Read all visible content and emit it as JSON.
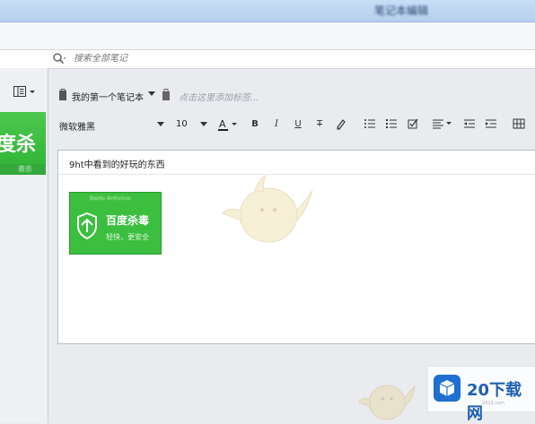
{
  "window": {
    "title": "笔记本编辑"
  },
  "search": {
    "placeholder": "搜索全部笔记"
  },
  "sidebar": {
    "thumb_text": "度杀",
    "thumb_foot": "查杀"
  },
  "note": {
    "notebook_name": "我的第一个笔记本",
    "tag_hint": "点击这里添加标签...",
    "title": "9ht中看到的好玩的东西"
  },
  "toolbar": {
    "font_family": "微软雅黑",
    "font_size": "10",
    "bold": "B",
    "italic": "I",
    "underline": "U",
    "strikethrough": "T"
  },
  "embedded_image": {
    "top_text": "Baidu Antivirus",
    "title": "百度杀毒",
    "subtitle": "轻快，更安全"
  },
  "watermark": {
    "brand": "20下载网",
    "domain": "2022.com"
  },
  "colors": {
    "accent_green": "#3cbf3f",
    "brand_blue": "#1d5fb3"
  }
}
